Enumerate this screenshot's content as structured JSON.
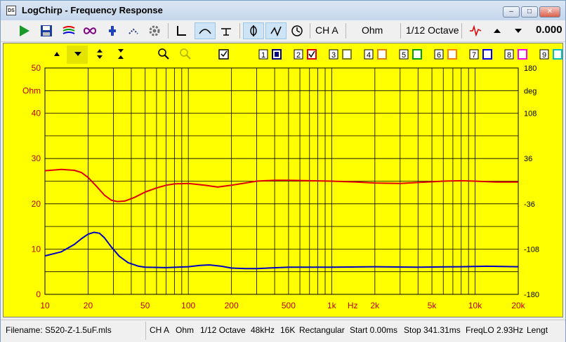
{
  "window": {
    "title": "LogChirp - Frequency Response",
    "icon_text": "DS"
  },
  "toolbar": {
    "channel": "CH A",
    "unit": "Ohm",
    "smoothing": "1/12 Octave",
    "readout": "0.000"
  },
  "plot_toolbar": {
    "channels": [
      "1",
      "2",
      "3",
      "4",
      "5",
      "6",
      "7",
      "8",
      "9"
    ],
    "channel_colors": [
      "#000080",
      "#e00000",
      "#808000",
      "#e08000",
      "#00a000",
      "#ff8000",
      "#0000ff",
      "#ff00ff",
      "#00c0c0"
    ]
  },
  "chart_data": {
    "type": "line",
    "x_scale": "log",
    "xlim": [
      10,
      20000
    ],
    "ylim_left": [
      0,
      50
    ],
    "ylim_right": [
      -180,
      180
    ],
    "ylabel_left": "Ohm",
    "ylabel_right": "deg",
    "x_tick_labels": [
      {
        "v": 10,
        "t": "10"
      },
      {
        "v": 20,
        "t": "20"
      },
      {
        "v": 50,
        "t": "50"
      },
      {
        "v": 100,
        "t": "100"
      },
      {
        "v": 200,
        "t": "200"
      },
      {
        "v": 500,
        "t": "500"
      },
      {
        "v": 1000,
        "t": "1k"
      },
      {
        "v": 2000,
        "t": "2k"
      },
      {
        "v": 5000,
        "t": "5k"
      },
      {
        "v": 10000,
        "t": "10k"
      },
      {
        "v": 20000,
        "t": "20k"
      }
    ],
    "x_unit_label": "Hz",
    "y_left_ticks": [
      0,
      10,
      20,
      30,
      40,
      50
    ],
    "y_right_ticks": [
      -180,
      -108,
      -36,
      36,
      108,
      180
    ],
    "grid": true,
    "series": [
      {
        "color": "#e00000",
        "points": [
          [
            10,
            27.3
          ],
          [
            13,
            27.6
          ],
          [
            16,
            27.4
          ],
          [
            18,
            26.9
          ],
          [
            20,
            25.8
          ],
          [
            23,
            23.8
          ],
          [
            26,
            21.9
          ],
          [
            29,
            20.8
          ],
          [
            32,
            20.5
          ],
          [
            36,
            20.6
          ],
          [
            42,
            21.4
          ],
          [
            50,
            22.6
          ],
          [
            60,
            23.5
          ],
          [
            70,
            24.1
          ],
          [
            80,
            24.4
          ],
          [
            100,
            24.5
          ],
          [
            130,
            24.1
          ],
          [
            160,
            23.7
          ],
          [
            200,
            24.1
          ],
          [
            250,
            24.6
          ],
          [
            300,
            25.0
          ],
          [
            400,
            25.2
          ],
          [
            500,
            25.2
          ],
          [
            700,
            25.1
          ],
          [
            1000,
            25.0
          ],
          [
            1500,
            24.8
          ],
          [
            2000,
            24.6
          ],
          [
            3000,
            24.5
          ],
          [
            4000,
            24.7
          ],
          [
            6000,
            25.0
          ],
          [
            8000,
            25.1
          ],
          [
            10000,
            25.0
          ],
          [
            14000,
            24.8
          ],
          [
            20000,
            24.8
          ]
        ]
      },
      {
        "color": "#0000c0",
        "points": [
          [
            10,
            8.5
          ],
          [
            13,
            9.4
          ],
          [
            16,
            11.0
          ],
          [
            18,
            12.3
          ],
          [
            20,
            13.3
          ],
          [
            22,
            13.7
          ],
          [
            24,
            13.5
          ],
          [
            26,
            12.5
          ],
          [
            29,
            10.5
          ],
          [
            33,
            8.4
          ],
          [
            38,
            7.0
          ],
          [
            45,
            6.2
          ],
          [
            50,
            6.0
          ],
          [
            70,
            5.9
          ],
          [
            100,
            6.1
          ],
          [
            120,
            6.4
          ],
          [
            140,
            6.5
          ],
          [
            170,
            6.2
          ],
          [
            200,
            5.8
          ],
          [
            250,
            5.7
          ],
          [
            300,
            5.7
          ],
          [
            500,
            6.0
          ],
          [
            1000,
            6.0
          ],
          [
            2000,
            6.1
          ],
          [
            4000,
            6.0
          ],
          [
            8000,
            6.1
          ],
          [
            12000,
            6.2
          ],
          [
            20000,
            6.1
          ]
        ]
      }
    ]
  },
  "statusbar": {
    "filename": "Filename: S520-Z-1.5uF.mls",
    "channel": "CH A",
    "unit": "Ohm",
    "smoothing": "1/12 Octave",
    "rate": "48kHz",
    "size": "16K",
    "window": "Rectangular",
    "start": "Start 0.00ms",
    "stop": "Stop 341.31ms",
    "freqlo": "FreqLO 2.93Hz",
    "length": "Lengt"
  }
}
